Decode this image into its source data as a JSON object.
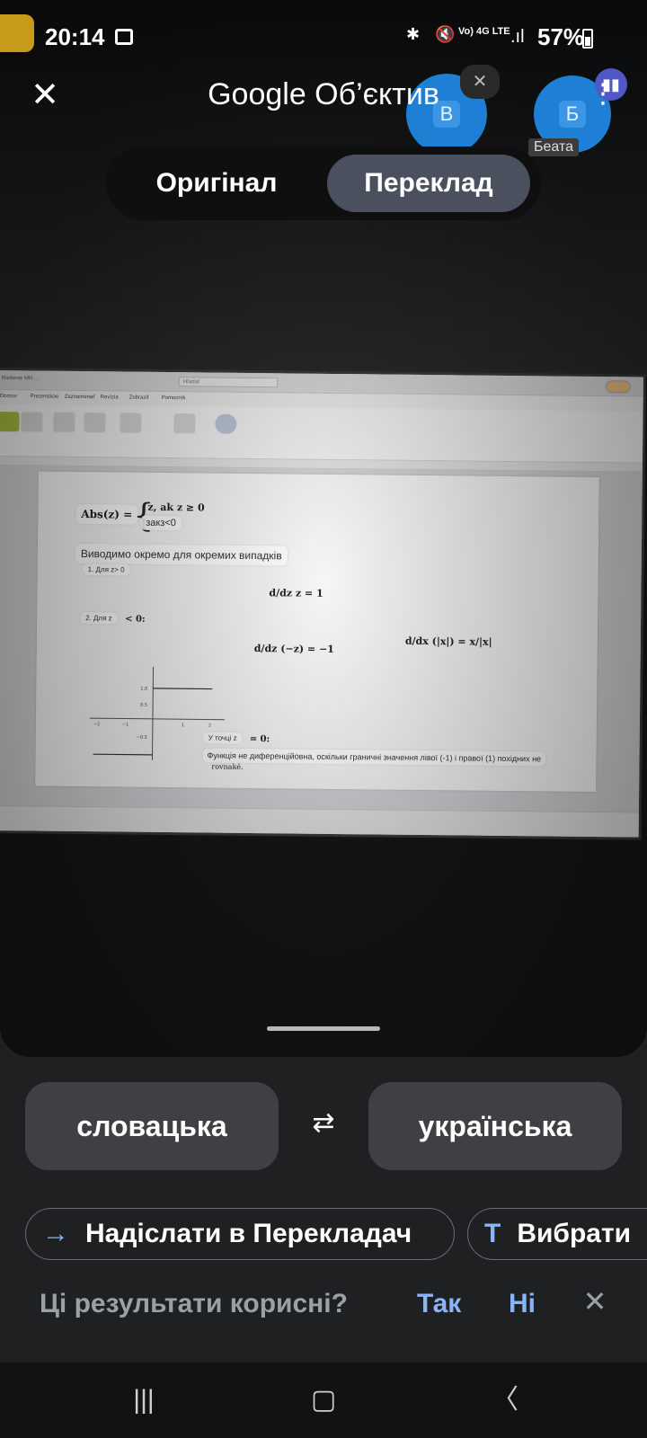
{
  "status_bar": {
    "time": "20:14",
    "network": "Vo) 4G LTE",
    "battery": "57%"
  },
  "app_bar": {
    "title": "Google Об’єктив"
  },
  "meeting_overlay": {
    "participant_b_initial": "В",
    "participant_beata_initial": "Б",
    "participant_beata_name": "Беата"
  },
  "mode_toggle": {
    "original_label": "Оригінал",
    "translate_label": "Переклад",
    "selected": "translate"
  },
  "document": {
    "abs_formula": "Abs(z) =",
    "case_pos": "z,   ak z ≥ 0",
    "case_neg": "закз<0",
    "derive_text": "Виводимо окремо для окремих випадків",
    "case1": "1. Для z> 0",
    "case2": "2. Для z",
    "case2_cond": "< 0:",
    "deriv1": "d/dz z = 1",
    "deriv2": "d/dz (−z) = −1",
    "deriv3": "d/dx (|x|) = x/|x|",
    "point_label": "У точці z",
    "point_cond": "= 0:",
    "conclusion": "Функція не диференційовна, оскільки граничні значення лівої (-1) і правої (1) похідних не",
    "conclusion_tail": "rovnaké."
  },
  "languages": {
    "source": "словацька",
    "target": "українська"
  },
  "actions": {
    "send_label": "Надіслати в Перекладач",
    "select_label": "Вибрати"
  },
  "feedback": {
    "question": "Ці результати корисні?",
    "yes": "Так",
    "no": "Ні"
  },
  "colors": {
    "accent": "#8ab4f8",
    "panel": "#1f2022",
    "button": "#3e4043",
    "selected_segment": "#4a505e"
  }
}
